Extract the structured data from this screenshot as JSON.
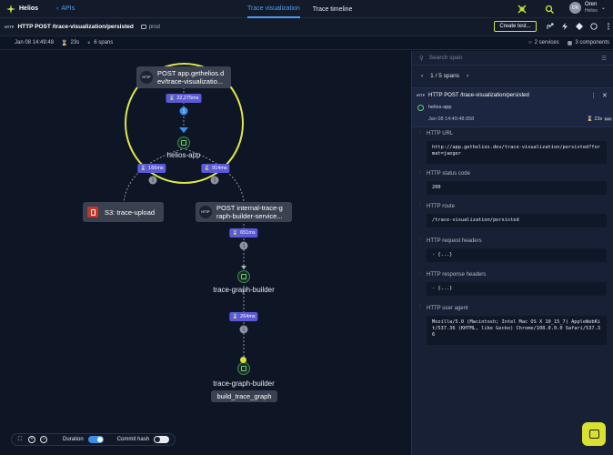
{
  "app": {
    "name": "Helios",
    "back_label": "APIs"
  },
  "tabs": [
    {
      "label": "Trace visualization",
      "active": true
    },
    {
      "label": "Trace timeline",
      "active": false
    }
  ],
  "user": {
    "initials": "OR",
    "name": "Oren",
    "org": "Helios"
  },
  "trace": {
    "badge": "HTTP",
    "title": "HTTP POST /trace-visualization/persisted",
    "env": "prod",
    "date": "Jan 08 14:49:48",
    "duration": "23s",
    "spans": "6 spans",
    "services": "2 services",
    "components": "3 components",
    "create_test_label": "Create test..."
  },
  "graph": {
    "root": {
      "badge": "HTTP",
      "label": "POST app.gethelios.dev/trace-visualizatio...",
      "line1": "POST app.gethelios.d",
      "line2": "ev/trace-visualizatio..."
    },
    "root_duration": "22,275ms",
    "root_count": "1",
    "service1": "helios-app",
    "edge_left_duration": "166ms",
    "edge_left_count": "1",
    "edge_right_duration": "914ms",
    "edge_right_count": "1",
    "s3_label": "S3:  trace-upload",
    "http2_badge": "HTTP",
    "http2_line1": "POST internal-trace-g",
    "http2_line2": "raph-builder-service...",
    "dur3": "651ms",
    "cnt3": "1",
    "service2": "trace-graph-builder",
    "dur4": "264ms",
    "cnt4": "1",
    "service3": "trace-graph-builder",
    "op_label": "build_trace_graph"
  },
  "controls": {
    "duration_label": "Duration",
    "duration_on": true,
    "commit_label": "Commit hash",
    "commit_on": false
  },
  "panel": {
    "search_placeholder": "Search span",
    "pager": "1 / 5 spans",
    "span_badge": "HTTP",
    "span_title": "HTTP POST /trace-visualization/persisted",
    "span_service": "helios-app",
    "span_time": "Jan 08 14:49:48.658",
    "span_duration": "23s",
    "span_duration_unit": "MAX",
    "fields": [
      {
        "label": "HTTP URL",
        "value": "http://app.gethelios.dev/trace-visualization/persisted?format=jaeger"
      },
      {
        "label": "HTTP status code",
        "value": "200"
      },
      {
        "label": "HTTP route",
        "value": "/trace-visualization/persisted"
      },
      {
        "label": "HTTP request headers",
        "value": "{...}"
      },
      {
        "label": "HTTP response headers",
        "value": "{...}"
      },
      {
        "label": "HTTP user agent",
        "value": "Mozilla/5.0 (Macintosh; Intel Mac OS X 10_15_7) AppleWebKit/537.36 (KHTML, like Gecko) Chrome/108.0.0.0 Safari/537.36"
      }
    ]
  },
  "colors": {
    "accent": "#4a9ff5",
    "highlight": "#dfe84a",
    "duration_badge": "#5a5ad8",
    "service": "#3c8a55"
  }
}
